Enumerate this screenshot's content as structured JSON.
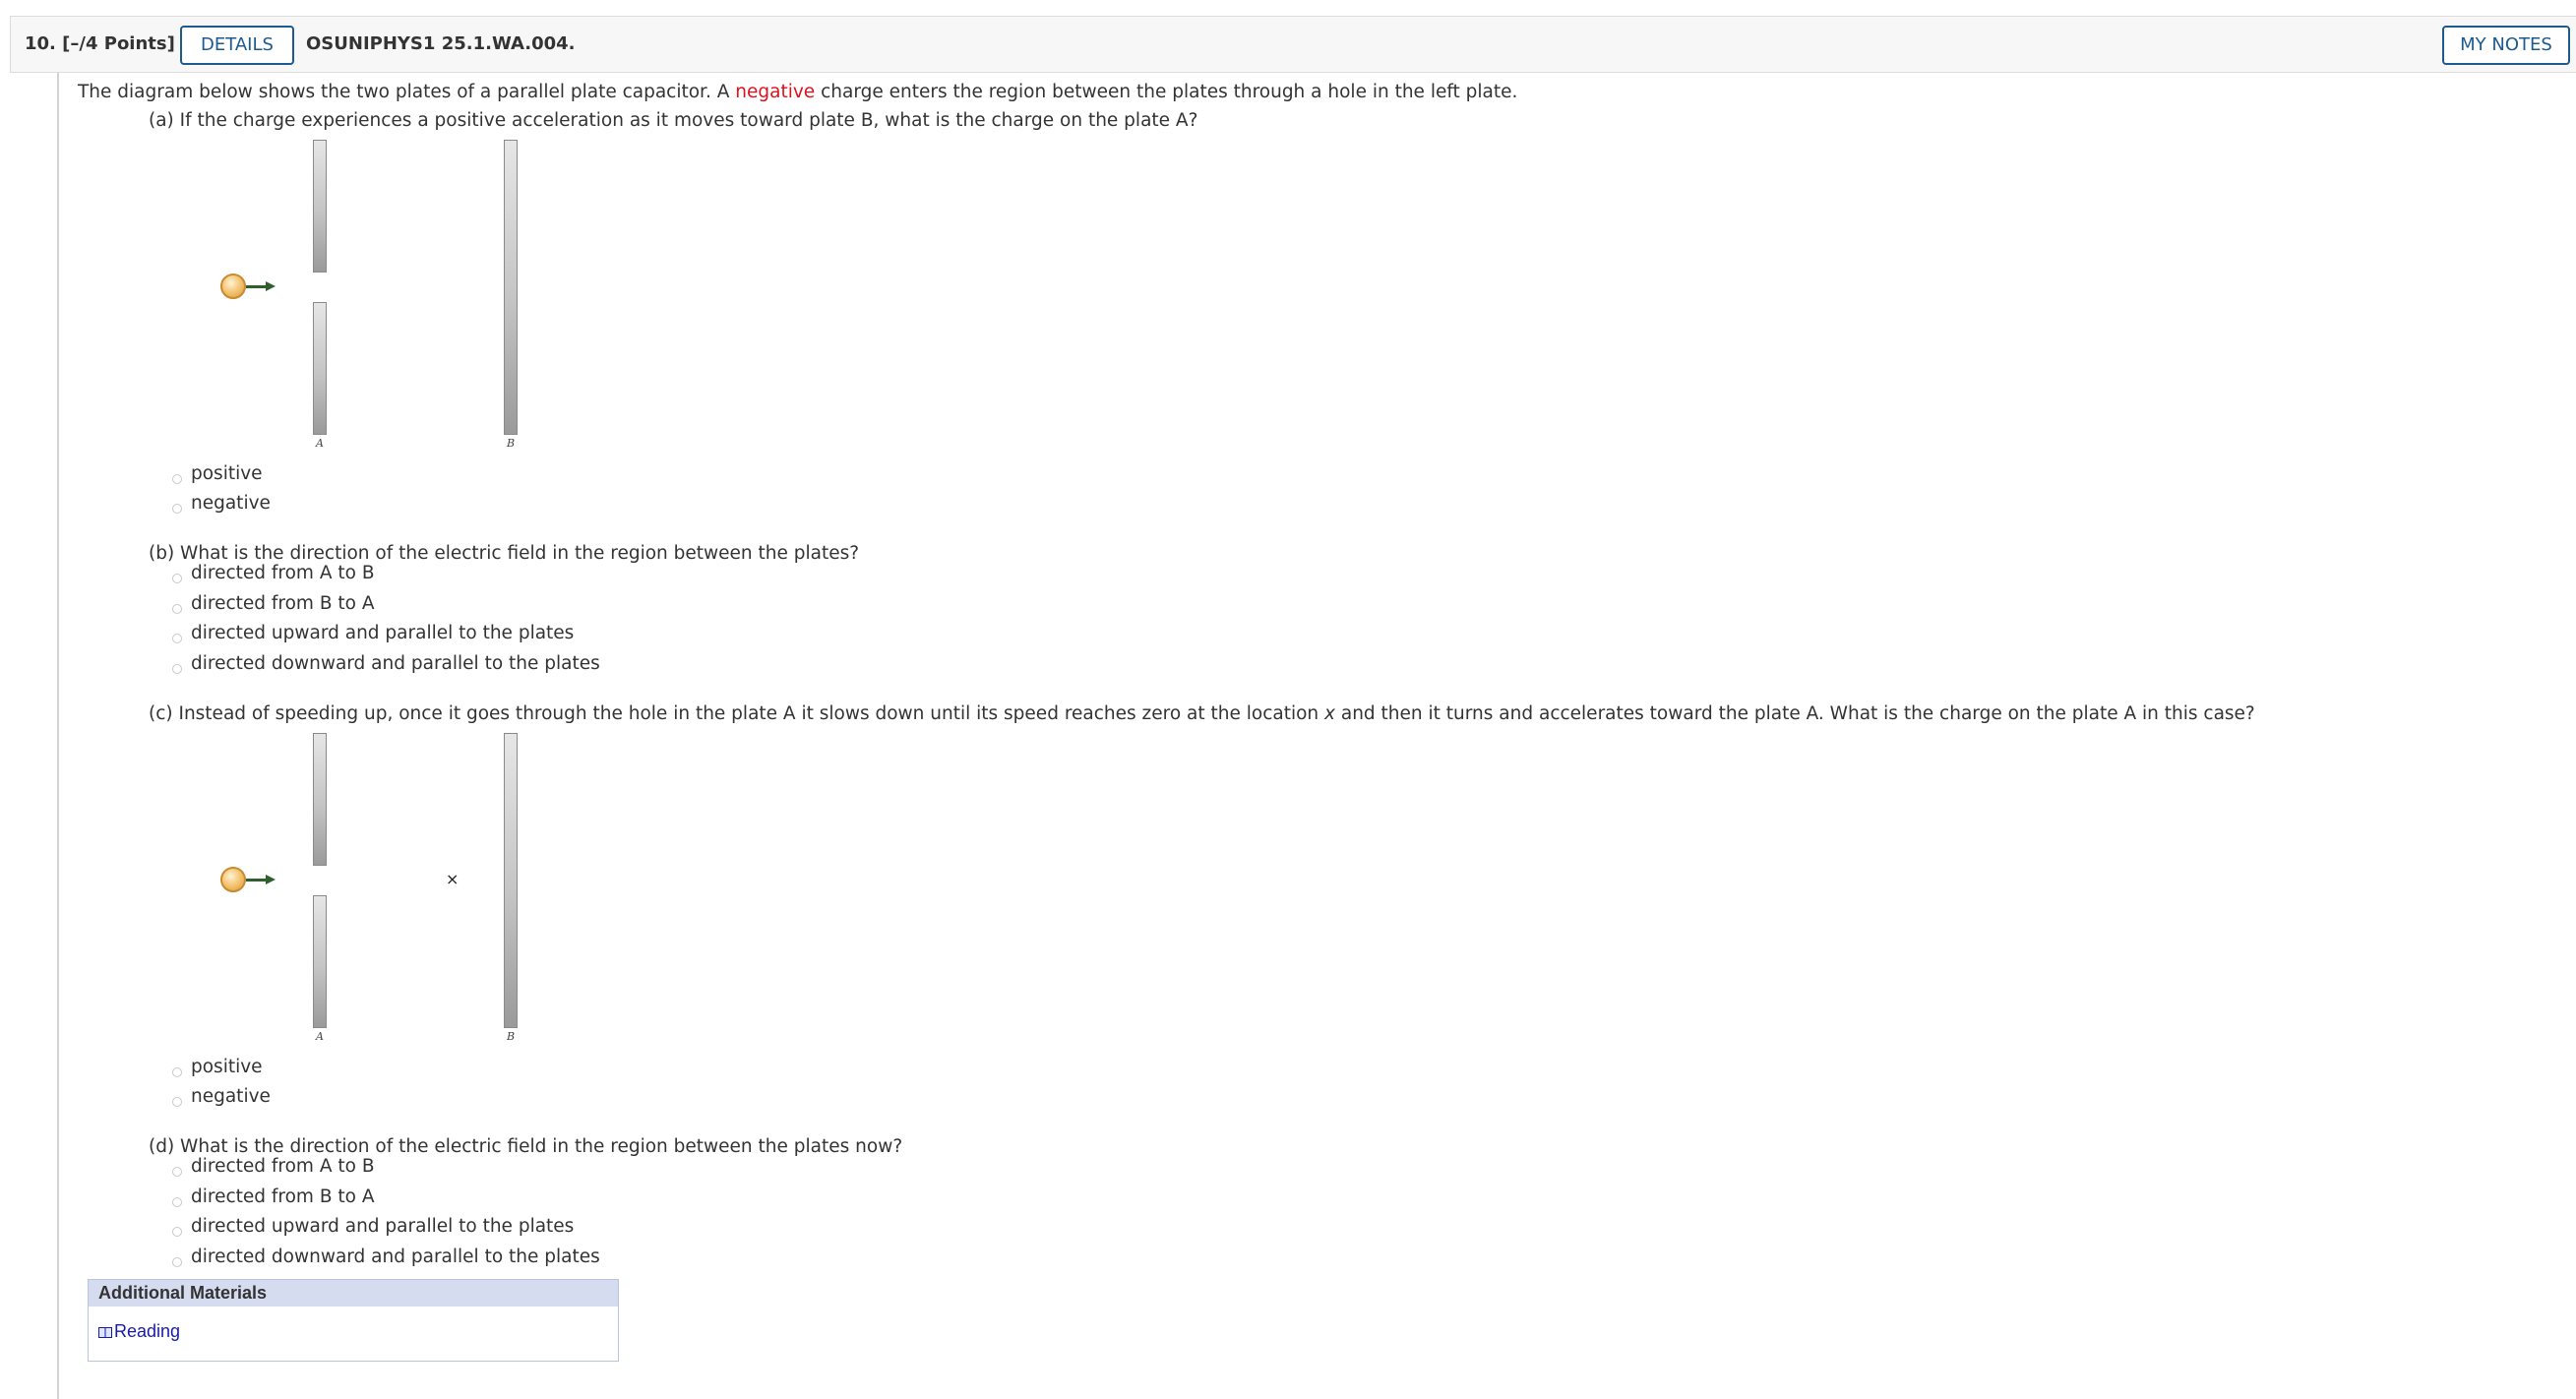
{
  "header": {
    "question_number": "10.  [–/4 Points]",
    "details_label": "DETAILS",
    "question_code": "OSUNIPHYS1 25.1.WA.004.",
    "my_notes_label": "MY NOTES"
  },
  "intro": {
    "before": "The diagram below shows the two plates of a parallel plate capacitor. A ",
    "highlight": "negative",
    "after": " charge enters the region between the plates through a hole in the left plate."
  },
  "part_a": {
    "question": "(a) If the charge experiences a positive acceleration as it moves toward plate B, what is the charge on the plate A?",
    "options": [
      "positive",
      "negative"
    ]
  },
  "part_b": {
    "question": "(b) What is the direction of the electric field in the region between the plates?",
    "options": [
      "directed from A to B",
      "directed from B to A",
      "directed upward and parallel to the plates",
      "directed downward and parallel to the plates"
    ]
  },
  "part_c": {
    "question_before": "(c) Instead of speeding up, once it goes through the hole in the plate A it slows down until its speed reaches zero at the location ",
    "question_var": "x",
    "question_after": " and then it turns and accelerates toward the plate A. What is the charge on the plate A in this case?",
    "options": [
      "positive",
      "negative"
    ]
  },
  "part_d": {
    "question": "(d) What is the direction of the electric field in the region between the plates now?",
    "options": [
      "directed from A to B",
      "directed from B to A",
      "directed upward and parallel to the plates",
      "directed downward and parallel to the plates"
    ]
  },
  "diagram": {
    "plate_a_label": "A",
    "plate_b_label": "B",
    "stop_marker": "×"
  },
  "additional_materials": {
    "title": "Additional Materials",
    "link_label": "Reading"
  }
}
